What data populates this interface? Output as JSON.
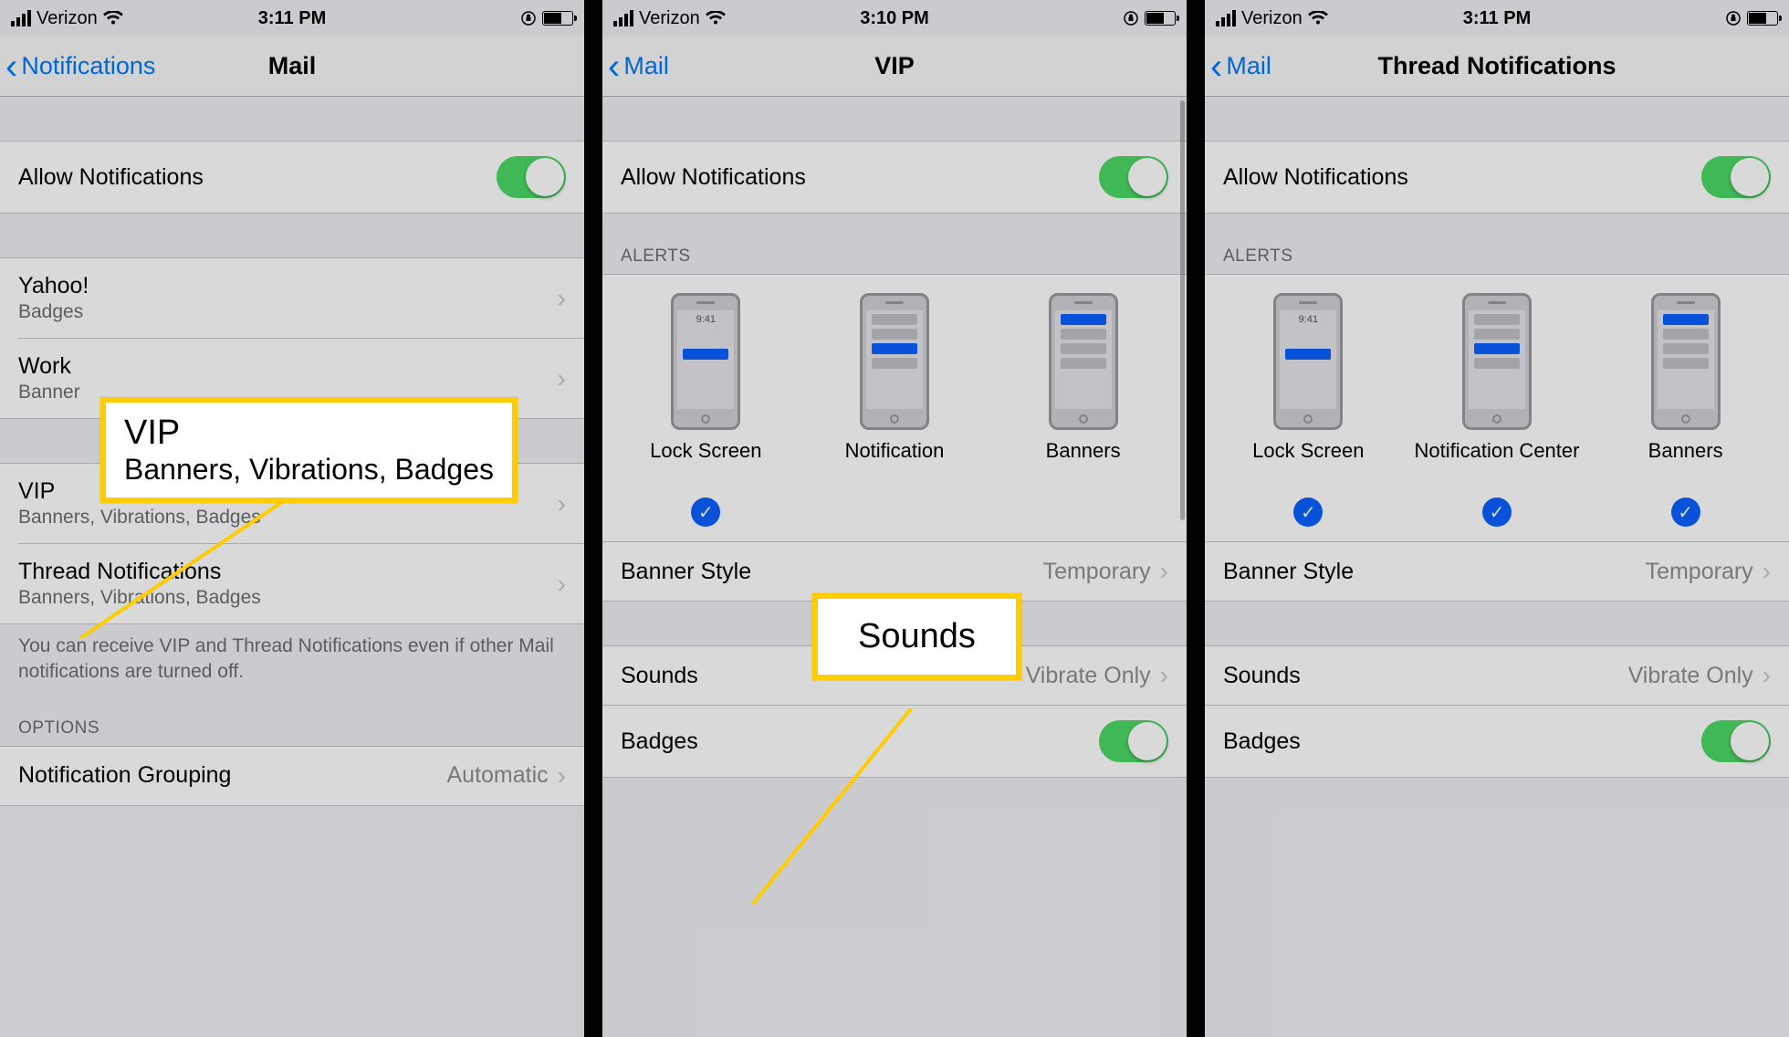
{
  "screens": [
    {
      "status": {
        "carrier": "Verizon",
        "time": "3:11 PM"
      },
      "nav": {
        "back": "Notifications",
        "title": "Mail"
      },
      "allow_label": "Allow Notifications",
      "accounts": [
        {
          "title": "Yahoo!",
          "sub": "Badges"
        },
        {
          "title": "Work",
          "sub": "Banner"
        }
      ],
      "vip": {
        "title": "VIP",
        "sub": "Banners, Vibrations, Badges"
      },
      "thread": {
        "title": "Thread Notifications",
        "sub": "Banners, Vibrations, Badges"
      },
      "footer": "You can receive VIP and Thread Notifications even if other Mail notifications are turned off.",
      "options_header": "OPTIONS",
      "grouping": {
        "label": "Notification Grouping",
        "value": "Automatic"
      }
    },
    {
      "status": {
        "carrier": "Verizon",
        "time": "3:10 PM"
      },
      "nav": {
        "back": "Mail",
        "title": "VIP"
      },
      "allow_label": "Allow Notifications",
      "alerts_header": "ALERTS",
      "alerts": [
        {
          "label": "Lock Screen",
          "checked": true,
          "variant": "lock"
        },
        {
          "label": "Notification",
          "checked": false,
          "variant": "center"
        },
        {
          "label": "Banners",
          "checked": false,
          "variant": "banner"
        }
      ],
      "banner_style": {
        "label": "Banner Style",
        "value": "Temporary"
      },
      "sounds": {
        "label": "Sounds",
        "value": "Vibrate Only"
      },
      "badges_label": "Badges"
    },
    {
      "status": {
        "carrier": "Verizon",
        "time": "3:11 PM"
      },
      "nav": {
        "back": "Mail",
        "title": "Thread Notifications"
      },
      "allow_label": "Allow Notifications",
      "alerts_header": "ALERTS",
      "alerts": [
        {
          "label": "Lock Screen",
          "checked": true,
          "variant": "lock"
        },
        {
          "label": "Notification Center",
          "checked": true,
          "variant": "center"
        },
        {
          "label": "Banners",
          "checked": true,
          "variant": "banner"
        }
      ],
      "banner_style": {
        "label": "Banner Style",
        "value": "Temporary"
      },
      "sounds": {
        "label": "Sounds",
        "value": "Vibrate Only"
      },
      "badges_label": "Badges"
    }
  ],
  "callouts": {
    "vip": {
      "title": "VIP",
      "sub": "Banners, Vibrations, Badges"
    },
    "sounds": {
      "title": "Sounds"
    }
  },
  "mini_time": "9:41"
}
